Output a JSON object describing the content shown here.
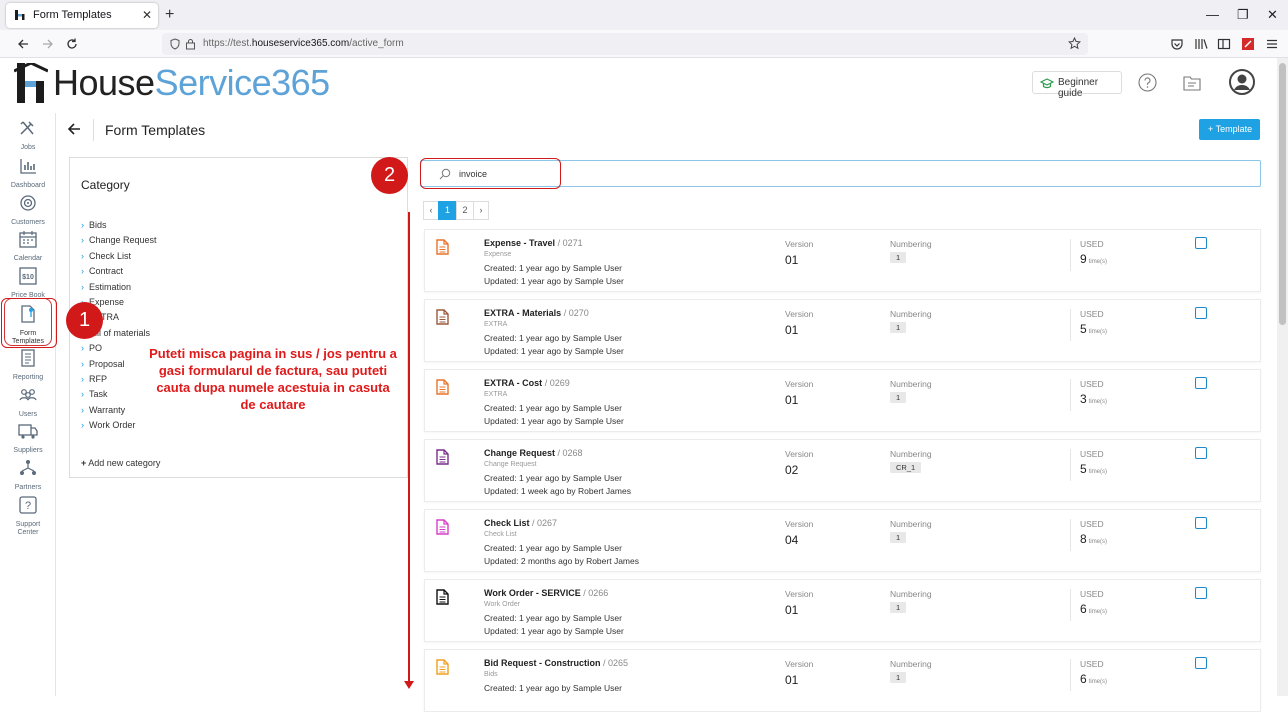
{
  "browser": {
    "tab_title": "Form Templates",
    "url_prefix": "https://test.",
    "url_domain": "houseservice365.com",
    "url_path": "/active_form"
  },
  "header": {
    "logo_part1": "House",
    "logo_part2": "Service365",
    "beginner_guide": "Beginner guide"
  },
  "sidebar": {
    "items": [
      {
        "label": "Jobs",
        "icon": "tools-icon"
      },
      {
        "label": "Dashboard",
        "icon": "bar-chart-icon"
      },
      {
        "label": "Customers",
        "icon": "target-icon"
      },
      {
        "label": "Calendar",
        "icon": "calendar-icon"
      },
      {
        "label": "Price Book",
        "icon": "price-tag-icon"
      },
      {
        "label": "Form\nTemplates",
        "icon": "form-icon"
      },
      {
        "label": "Reporting",
        "icon": "report-icon"
      },
      {
        "label": "Users",
        "icon": "users-icon"
      },
      {
        "label": "Suppliers",
        "icon": "truck-icon"
      },
      {
        "label": "Partners",
        "icon": "partners-icon"
      },
      {
        "label": "Support\nCenter",
        "icon": "help-icon"
      }
    ]
  },
  "page": {
    "title": "Form Templates",
    "add_button": "+ Template"
  },
  "category": {
    "title": "Category",
    "items": [
      "Bids",
      "Change Request",
      "Check List",
      "Contract",
      "Estimation",
      "Expense",
      "EXTRA",
      "Bill of materials",
      "PO",
      "Proposal",
      "RFP",
      "Task",
      "Warranty",
      "Work Order"
    ],
    "add_new": "Add new category"
  },
  "search": {
    "value": "invoice"
  },
  "pagination": {
    "prev": "‹",
    "pages": [
      "1",
      "2"
    ],
    "next": "›",
    "active": "1"
  },
  "columns": {
    "version": "Version",
    "numbering": "Numbering",
    "used": "USED",
    "times_unit": "time(s)"
  },
  "templates": [
    {
      "name": "Expense - Travel",
      "id": "/ 0271",
      "category": "Expense",
      "created": "Created: 1 year ago by Sample User",
      "updated": "Updated: 1 year ago by Sample User",
      "version": "01",
      "numbering": "1",
      "used": "9",
      "icon_color": "#e8742a"
    },
    {
      "name": "EXTRA - Materials",
      "id": "/ 0270",
      "category": "EXTRA",
      "created": "Created: 1 year ago by Sample User",
      "updated": "Updated: 1 year ago by Sample User",
      "version": "01",
      "numbering": "1",
      "used": "5",
      "icon_color": "#9b5a3c"
    },
    {
      "name": "EXTRA - Cost",
      "id": "/ 0269",
      "category": "EXTRA",
      "created": "Created: 1 year ago by Sample User",
      "updated": "Updated: 1 year ago by Sample User",
      "version": "01",
      "numbering": "1",
      "used": "3",
      "icon_color": "#e8742a"
    },
    {
      "name": "Change Request",
      "id": "/ 0268",
      "category": "Change Request",
      "created": "Created: 1 year ago by Sample User",
      "updated": "Updated: 1 week ago by Robert James",
      "version": "02",
      "numbering": "CR_1",
      "used": "5",
      "icon_color": "#7a2d8c"
    },
    {
      "name": "Check List",
      "id": "/ 0267",
      "category": "Check List",
      "created": "Created: 1 year ago by Sample User",
      "updated": "Updated: 2 months ago by Robert James",
      "version": "04",
      "numbering": "1",
      "used": "8",
      "icon_color": "#d63ec8"
    },
    {
      "name": "Work Order - SERVICE",
      "id": "/ 0266",
      "category": "Work Order",
      "created": "Created: 1 year ago by Sample User",
      "updated": "Updated: 1 year ago by Sample User",
      "version": "01",
      "numbering": "1",
      "used": "6",
      "icon_color": "#111111"
    },
    {
      "name": "Bid Request - Construction",
      "id": "/ 0265",
      "category": "Bids",
      "created": "Created: 1 year ago by Sample User",
      "updated": "",
      "version": "01",
      "numbering": "1",
      "used": "6",
      "icon_color": "#f0a020"
    }
  ],
  "annotations": {
    "badge1": "1",
    "badge2": "2",
    "note": "Puteti misca pagina in sus / jos pentru a gasi formularul de factura, sau puteti cauta dupa numele acestuia in casuta de cautare"
  },
  "colors": {
    "accent": "#1ea2e4",
    "annotation_red": "#d21919",
    "logo_blue": "#5ea3d8"
  }
}
